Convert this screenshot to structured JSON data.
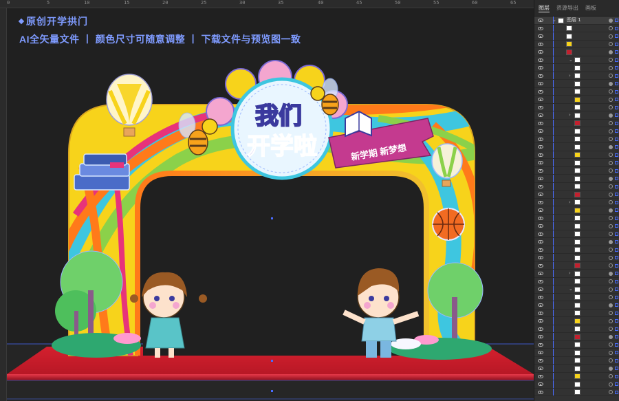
{
  "ruler": {
    "marks": [
      "0",
      "5",
      "10",
      "15",
      "20",
      "25",
      "30",
      "35",
      "40",
      "45",
      "50",
      "55",
      "60",
      "65"
    ]
  },
  "headline": {
    "title": "原创开学拱门",
    "subtitle": "AI全矢量文件 丨 颜色尺寸可随意调整 丨 下载文件与预览图一致"
  },
  "artwork": {
    "main_title": "我们开学啦",
    "line1": "我们",
    "line2": "开学啦",
    "ribbon": "新学期 新梦想"
  },
  "panel": {
    "tabs": [
      "图层",
      "资源导出",
      "画板"
    ],
    "active_tab": "图层",
    "top_layer_name": "图层 1"
  },
  "colors": {
    "accent_blue": "#4a6cff",
    "headline": "#7f9bff",
    "arch_yellow": "#f7d31b",
    "stage_red": "#c4202e"
  }
}
